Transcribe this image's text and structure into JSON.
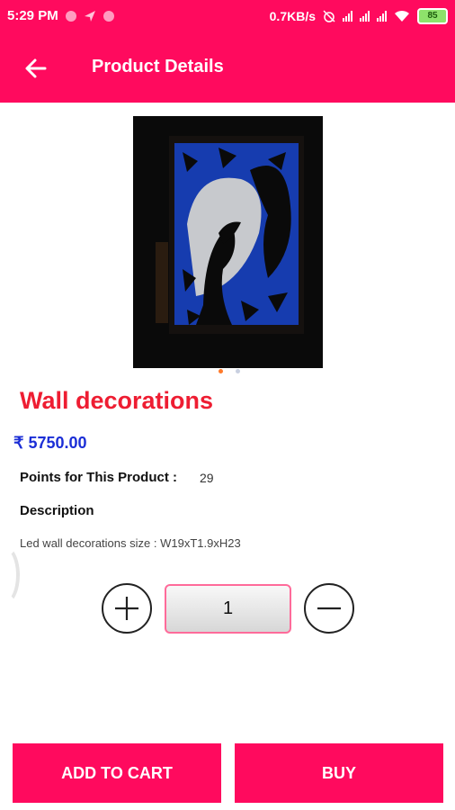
{
  "status_bar": {
    "time": "5:29 PM",
    "speed": "0.7KB/s",
    "battery": "85"
  },
  "app_bar": {
    "title": "Product Details"
  },
  "product": {
    "name": "Wall decorations",
    "price": "₹ 5750.00",
    "points_label": "Points for This Product :",
    "points_value": "29",
    "description_heading": "Description",
    "description": "Led wall decorations  size : W19xT1.9xH23",
    "image_indicator": {
      "count": 2,
      "active": 1
    }
  },
  "quantity": {
    "value": "1"
  },
  "actions": {
    "add_to_cart": "ADD TO CART",
    "buy": "BUY"
  },
  "colors": {
    "accent": "#ff0a5e",
    "product_name": "#ee1d32",
    "price": "#1b2ed6",
    "quantity_border": "#ff6b9a"
  }
}
